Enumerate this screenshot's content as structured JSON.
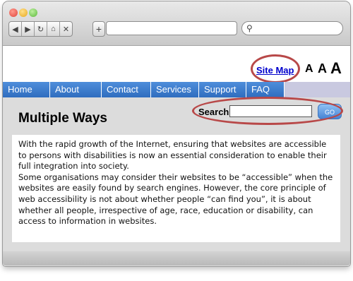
{
  "browser": {
    "buttons": {
      "back_icon": "triangle-left",
      "forward_icon": "triangle-right",
      "reload_icon": "reload",
      "home_icon": "home",
      "stop_icon": "close",
      "new_tab_label": "+",
      "search_icon": "magnifier"
    },
    "url": "",
    "search_value": ""
  },
  "header": {
    "site_map_label": "Site Map",
    "font_size_labels": [
      "A",
      "A",
      "A"
    ]
  },
  "menu": {
    "items": [
      "Home",
      "About",
      "Contact",
      "Services",
      "Support",
      "FAQ"
    ]
  },
  "main": {
    "title": "Multiple Ways",
    "search_label": "Search",
    "search_value": "",
    "go_label": "GO",
    "paragraphs": [
      "With the rapid growth of the Internet, ensuring that websites are accessible to persons with disabilities is now an essential consideration to enable their full integration into society.",
      "Some organisations may consider their websites to be “accessible” when the websites are easily found by search engines. However, the core principle of web accessibility is not about whether people “can find you”, it is about whether all people, irrespective of age, race, education or disability, can access to information in websites."
    ]
  },
  "colors": {
    "menu_blue": "#3a7ccc",
    "annotation_red": "#b84848",
    "link_blue": "#0000cc",
    "content_gray": "#dcdcdc"
  }
}
